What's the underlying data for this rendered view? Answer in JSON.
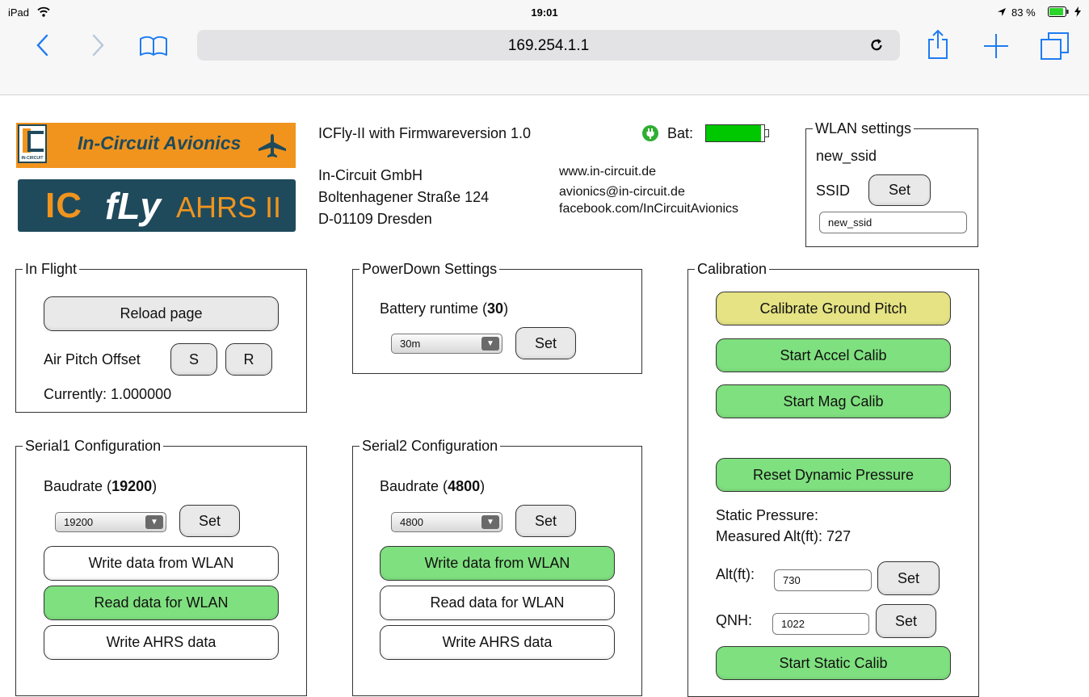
{
  "status_bar": {
    "device": "iPad",
    "wifi_icon": "wifi-icon",
    "time": "19:01",
    "battery_percent": "83 %",
    "location_icon": "location-arrow-icon",
    "battery_icon": "battery-icon",
    "charging_icon": "charging-bolt-icon"
  },
  "browser": {
    "url": "169.254.1.1",
    "back_icon": "chevron-left-icon",
    "forward_icon": "chevron-right-icon",
    "bookmarks_icon": "book-icon",
    "reload_icon": "reload-icon",
    "share_icon": "share-icon",
    "new_tab_icon": "plus-icon",
    "tabs_icon": "tabs-icon"
  },
  "logo": {
    "brand": "In-Circuit Avionics",
    "badge_text": "IN-CIRCUIT",
    "product_ic": "IC",
    "product_fly": "fLy",
    "product_ahrs": "AHRS II",
    "plane_icon": "airplane-icon"
  },
  "info": {
    "firmware": "ICFly-II with Firmwareversion 1.0",
    "company": "In-Circuit GmbH",
    "street": "Boltenhagener Straße 124",
    "city": "D-01109 Dresden",
    "web": "www.in-circuit.de",
    "email": "avionics@in-circuit.de",
    "facebook": "facebook.com/InCircuitAvionics"
  },
  "battery": {
    "label": "Bat:",
    "plug_icon": "power-plug-icon",
    "level": 0.95,
    "color": "#00c800"
  },
  "wlan": {
    "legend": "WLAN settings",
    "current_ssid": "new_ssid",
    "ssid_label": "SSID",
    "set_label": "Set",
    "input_value": "new_ssid"
  },
  "in_flight": {
    "legend": "In Flight",
    "reload_label": "Reload page",
    "air_pitch_label": "Air Pitch Offset",
    "s_label": "S",
    "r_label": "R",
    "currently": "Currently: 1.000000"
  },
  "powerdown": {
    "legend": "PowerDown Settings",
    "runtime_label": "Battery runtime (",
    "runtime_value": "30",
    "runtime_close": ")",
    "select_value": "30m",
    "set_label": "Set"
  },
  "serial1": {
    "legend": "Serial1 Configuration",
    "baud_label": "Baudrate (",
    "baud_value": "19200",
    "baud_close": ")",
    "select_value": "19200",
    "set_label": "Set",
    "write_wlan": "Write data from WLAN",
    "read_wlan": "Read data for WLAN",
    "write_ahrs": "Write AHRS data"
  },
  "serial2": {
    "legend": "Serial2 Configuration",
    "baud_label": "Baudrate (",
    "baud_value": "4800",
    "baud_close": ")",
    "select_value": "4800",
    "set_label": "Set",
    "write_wlan": "Write data from WLAN",
    "read_wlan": "Read data for WLAN",
    "write_ahrs": "Write AHRS data"
  },
  "calibration": {
    "legend": "Calibration",
    "ground_pitch": "Calibrate Ground Pitch",
    "accel": "Start Accel Calib",
    "mag": "Start Mag Calib",
    "reset_pressure": "Reset Dynamic Pressure",
    "static_pressure": "Static Pressure:",
    "measured_alt": "Measured Alt(ft): 727",
    "alt_label": "Alt(ft):",
    "alt_value": "730",
    "qnh_label": "QNH:",
    "qnh_value": "1022",
    "set_label": "Set",
    "static_calib": "Start Static Calib"
  },
  "colors": {
    "active_green": "#7fe07f",
    "ground_pitch_yellow": "#e5e383",
    "logo_orange": "#f0941e",
    "logo_navy": "#1f4a5c",
    "ios_blue": "#1e7cf2"
  }
}
